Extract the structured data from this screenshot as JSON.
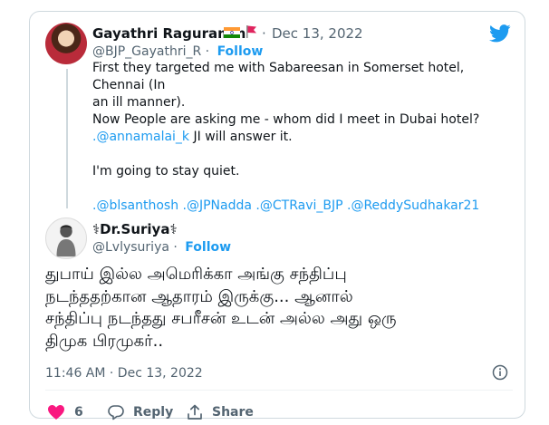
{
  "tweet": {
    "author_name": "Gayathri Raguramm",
    "dot": "·",
    "date": "Dec 13, 2022",
    "handle": "@BJP_Gayathri_R",
    "follow_label": "Follow",
    "lines": [
      "First they targeted me with Sabareesan in Somerset hotel, Chennai (In",
      "an ill manner).",
      "Now People are asking me - whom did I meet in Dubai hotel?"
    ],
    "mention_prefix": ".",
    "mention": "@annamalai_k",
    "mention_suffix": " JI will answer it.",
    "quiet_line": "I'm going to stay quiet.",
    "tags": [
      ".@blsanthosh",
      " .@JPNadda",
      " .@CTRavi_BJP",
      " .@ReddySudhakar21"
    ]
  },
  "reply": {
    "author_name": "⚕Dr.Suriya⚕",
    "handle": "@Lvlysuriya",
    "dot": "·",
    "follow_label": "Follow",
    "text_lines": [
      "துபாய் இல்ல அமெரிக்கா அங்கு சந்திப்பு",
      "நடந்ததற்கான ஆதாரம் இருக்கு... ஆனால்",
      "சந்திப்பு நடந்தது சபரீசன் உடன் அல்ல அது ஒரு",
      "திமுக பிரமுகர்.."
    ],
    "timestamp": "11:46 AM · Dec 13, 2022"
  },
  "actions": {
    "like_count": "6",
    "reply_label": "Reply",
    "share_label": "Share"
  },
  "colors": {
    "accent": "#1d9bf0",
    "like": "#f91880",
    "muted": "#536471"
  }
}
